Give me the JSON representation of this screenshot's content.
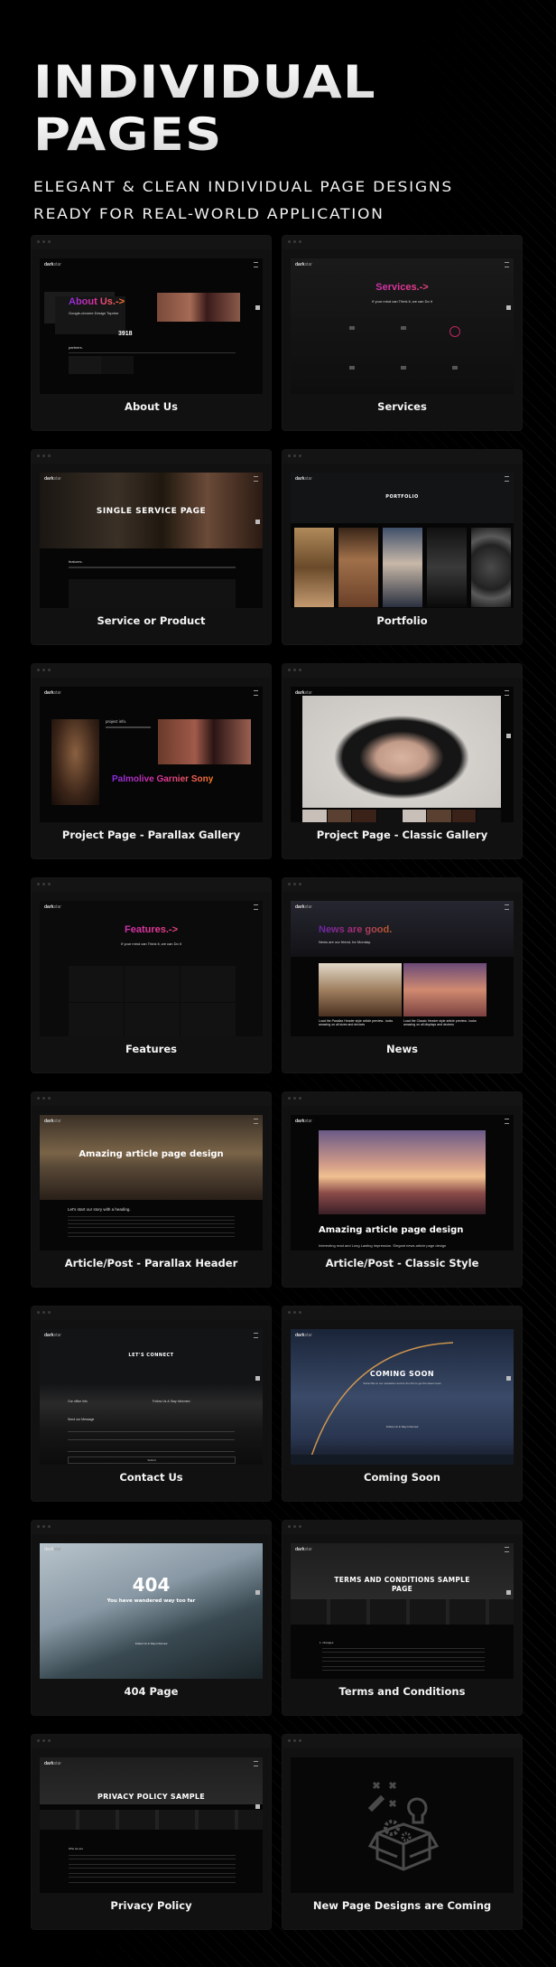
{
  "header": {
    "title_line1": "INDIVIDUAL",
    "title_line2": "PAGES",
    "subtitle_line1": "ELEGANT & CLEAN INDIVIDUAL PAGE DESIGNS",
    "subtitle_line2": "READY FOR REAL-WORLD APPLICATION"
  },
  "brand": {
    "logo_bold": "dark",
    "logo_light": "star"
  },
  "cards": [
    {
      "label": "About Us",
      "preview_heading": "About Us.->",
      "preview_tagline": "Google-chrome Design Toprine",
      "preview_stat": "3918",
      "preview_section": "partners."
    },
    {
      "label": "Services",
      "preview_heading": "Services.->",
      "preview_tagline": "If your mind can Think it, we can Do it"
    },
    {
      "label": "Service or Product",
      "preview_heading": "SINGLE SERVICE PAGE",
      "preview_section": "features."
    },
    {
      "label": "Portfolio",
      "preview_heading": "PORTFOLIO"
    },
    {
      "label": "Project Page - Parallax Gallery",
      "preview_heading": "Palmolive Garnier Sony",
      "preview_section": "project info."
    },
    {
      "label": "Project Page - Classic Gallery"
    },
    {
      "label": "Features",
      "preview_heading": "Features.->",
      "preview_tagline": "If your mind can Think it, we can Do it"
    },
    {
      "label": "News",
      "preview_heading": "News are good.",
      "preview_tagline": "News are our friend, for Monday.",
      "preview_item1": "Load the Parallax Header style article preview.. looks amazing on all sizes and devices",
      "preview_item2": "Load the Classic Header style article preview.. looks amazing on all displays and devices"
    },
    {
      "label": "Article/Post - Parallax Header",
      "preview_heading": "Amazing article page design",
      "preview_section": "Let's start our story with a heading."
    },
    {
      "label": "Article/Post - Classic Style",
      "preview_heading": "Amazing article page design",
      "preview_tagline": "Interesting read and Long Lasting Impression. Elegant news article page design"
    },
    {
      "label": "Contact Us",
      "preview_heading": "LET'S CONNECT",
      "preview_section": "Our office info",
      "preview_follow": "Follow Us & Stay Informed",
      "preview_send": "Send our Message",
      "preview_submit": "Submit"
    },
    {
      "label": "Coming Soon",
      "preview_heading": "COMING SOON",
      "preview_tagline": "Subscribe to our newsletter and be the first to get the latest news",
      "preview_follow": "Follow Us & Stay Informed"
    },
    {
      "label": "404 Page",
      "preview_heading": "404",
      "preview_tagline": "You have wandered way too far",
      "preview_follow": "Follow Us & Stay Informed"
    },
    {
      "label": "Terms and Conditions",
      "preview_heading": "TERMS AND CONDITIONS SAMPLE PAGE",
      "preview_section": "1. Changes"
    },
    {
      "label": "Privacy Policy",
      "preview_heading": "PRIVACY POLICY SAMPLE",
      "preview_section": "Who we are"
    },
    {
      "label": "New Page Designs are Coming",
      "preview_icon": "magic-box-icon"
    }
  ],
  "colors": {
    "background": "#000000",
    "card": "#111111",
    "gradient_start": "#8a2be2",
    "gradient_mid": "#e0359a",
    "gradient_end": "#ff7a2a"
  }
}
